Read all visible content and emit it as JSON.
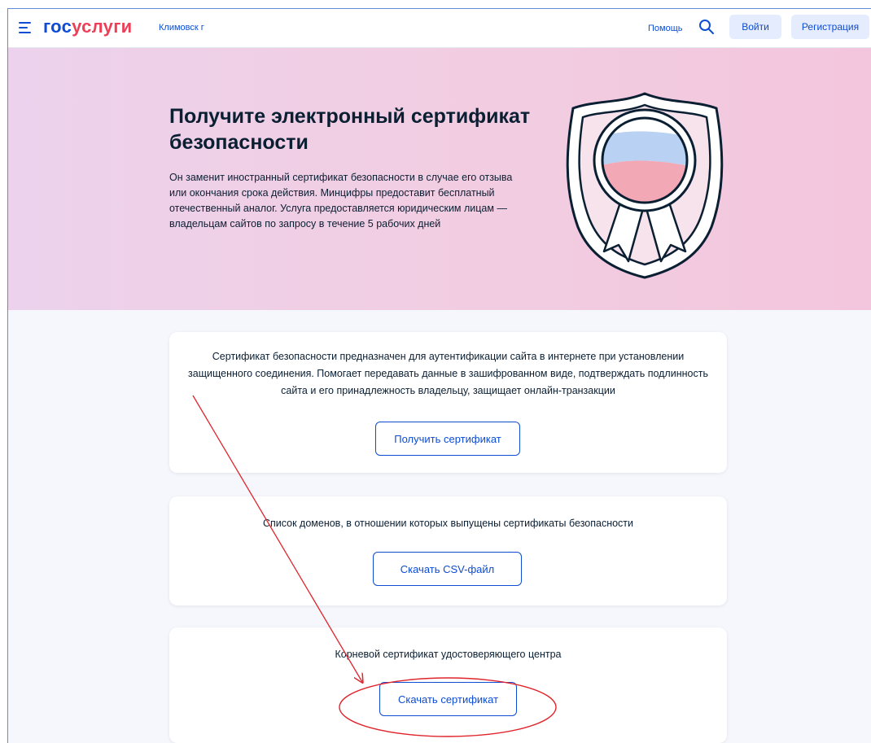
{
  "header": {
    "logo_part1": "гос",
    "logo_part2": "услуги",
    "city": "Климовск г",
    "help": "Помощь",
    "login": "Войти",
    "register": "Регистрация"
  },
  "hero": {
    "title": "Получите электронный сертификат безопасности",
    "description": "Он заменит иностранный сертификат безопасности в случае его отзыва или окончания срока действия. Минцифры предоставит бесплатный отечественный аналог. Услуга предоставляется юридическим лицам — владельцам сайтов по запросу в течение 5 рабочих дней"
  },
  "cards": [
    {
      "text": "Сертификат безопасности предназначен для аутентификации сайта в интернете при установлении защищенного соединения. Помогает передавать данные в зашифрованном виде, подтверждать подлинность сайта и его принадлежность владельцу, защищает онлайн-транзакции",
      "button": "Получить сертификат"
    },
    {
      "text": "Список доменов, в отношении которых выпущены сертификаты безопасности",
      "button": "Скачать CSV-файл"
    },
    {
      "text": "Корневой сертификат удостоверяющего центра",
      "button": "Скачать сертификат"
    }
  ],
  "icons": [
    "burger-menu-icon",
    "search-icon",
    "certificate-medal-icon"
  ],
  "colors": {
    "primary": "#0d4cd3",
    "logo_red": "#ee3f58",
    "annotation": "#e0242b",
    "hero_bg": "#f2cde1"
  }
}
